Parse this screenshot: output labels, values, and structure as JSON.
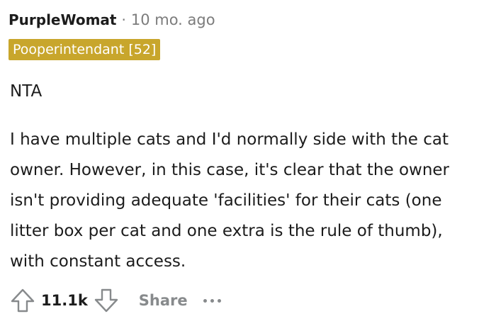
{
  "comment": {
    "username": "PurpleWomat",
    "separator": "·",
    "timestamp": "10 mo. ago",
    "flair": {
      "text": "Pooperintendant [52]",
      "color": "#c8a62c"
    },
    "verdict": "NTA",
    "body": "I have multiple cats and I'd normally side with the cat owner. However, in this case, it's clear that the owner isn't providing adequate 'facilities' for their cats (one litter box per cat and one extra is the rule of thumb), with constant access."
  },
  "actions": {
    "upvote_icon": "arrow-up-outline-icon",
    "score": "11.1k",
    "downvote_icon": "arrow-down-outline-icon",
    "share_label": "Share",
    "more_icon": "ellipsis-icon"
  },
  "colors": {
    "text": "#1c1c1c",
    "meta": "#7c7c7c",
    "action_gray": "#878a8c"
  }
}
